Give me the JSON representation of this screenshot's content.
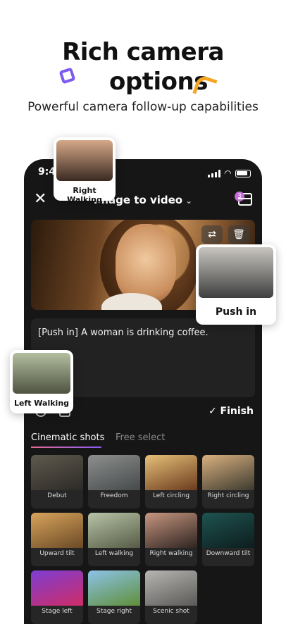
{
  "hero": {
    "title_line1": "Rich camera",
    "title_line2": "options",
    "subtitle": "Powerful camera follow-up capabilities"
  },
  "status": {
    "time": "9:41"
  },
  "nav": {
    "title": "Image to video",
    "close_glyph": "✕",
    "cart_badge": "3"
  },
  "preview": {
    "swap_glyph": "⇄",
    "delete_glyph": "🗑"
  },
  "prompt": {
    "text": "[Push in] A woman is drinking coffee."
  },
  "toolbar": {
    "finish_label": "✓ Finish"
  },
  "tabs": [
    {
      "label": "Cinematic shots"
    },
    {
      "label": "Free select"
    }
  ],
  "shots": [
    {
      "label": "Debut",
      "colors": [
        "#5f5a4e",
        "#2c2a26"
      ]
    },
    {
      "label": "Freedom",
      "colors": [
        "#8c8f8e",
        "#474a4a"
      ]
    },
    {
      "label": "Left circling",
      "colors": [
        "#e7c07a",
        "#6b3b1c"
      ]
    },
    {
      "label": "Right circling",
      "colors": [
        "#d9b07f",
        "#3c3a2f"
      ]
    },
    {
      "label": "Upward tilt",
      "colors": [
        "#d8a45c",
        "#6b4a26"
      ]
    },
    {
      "label": "Left walking",
      "colors": [
        "#b7c3a6",
        "#565b45"
      ]
    },
    {
      "label": "Right walking",
      "colors": [
        "#c89680",
        "#2d2420"
      ]
    },
    {
      "label": "Downward tilt",
      "colors": [
        "#1e5350",
        "#0d1d1e"
      ]
    },
    {
      "label": "Stage left",
      "colors": [
        "#7d3ed3",
        "#cf2c66"
      ]
    },
    {
      "label": "Stage right",
      "colors": [
        "#8cc3e8",
        "#5f8f3a"
      ]
    },
    {
      "label": "Scenic shot",
      "colors": [
        "#b8b6b3",
        "#5b5957"
      ]
    }
  ],
  "overlays": {
    "right_walking": "Right Walking",
    "push_in": "Push in",
    "left_walking": "Left Walking"
  }
}
